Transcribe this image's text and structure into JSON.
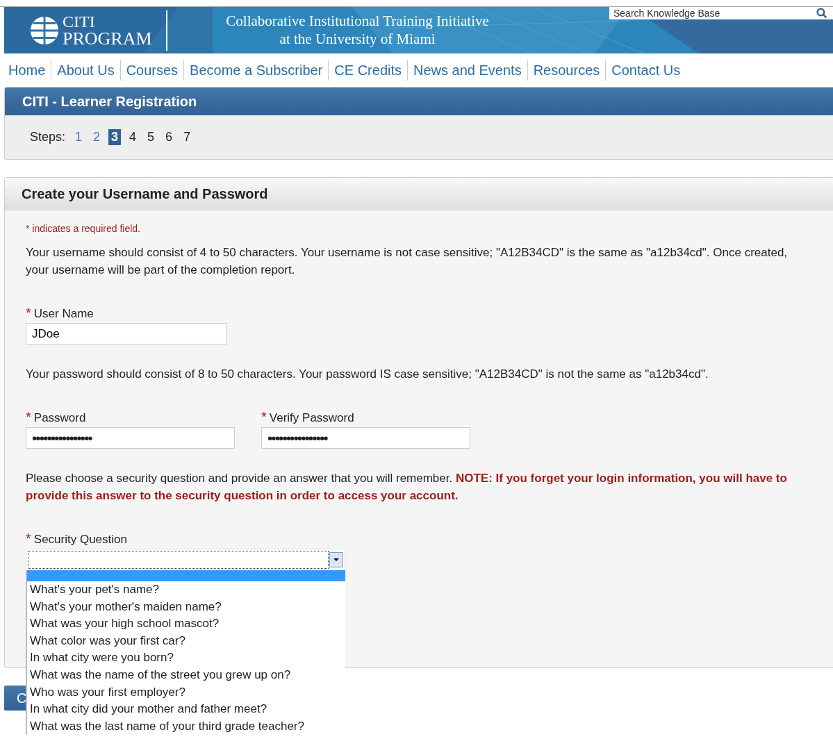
{
  "banner": {
    "logo_top": "CITI",
    "logo_bottom": "PROGRAM",
    "tagline": [
      "Collaborative Institutional Training Initiative",
      "at the University of Miami"
    ],
    "search": {
      "placeholder": "Search Knowledge Base"
    }
  },
  "nav": [
    "Home",
    "About Us",
    "Courses",
    "Become a Subscriber",
    "CE Credits",
    "News and Events",
    "Resources",
    "Contact Us"
  ],
  "registration": {
    "title": "CITI - Learner Registration",
    "steps_label": "Steps:",
    "steps": [
      {
        "label": "1",
        "kind": "done",
        "selected": false
      },
      {
        "label": "2",
        "kind": "done",
        "selected": false
      },
      {
        "label": "3",
        "kind": "current",
        "selected": true
      },
      {
        "label": "4",
        "kind": "todo",
        "selected": false
      },
      {
        "label": "5",
        "kind": "todo",
        "selected": false
      },
      {
        "label": "6",
        "kind": "todo",
        "selected": false
      },
      {
        "label": "7",
        "kind": "todo",
        "selected": false
      }
    ]
  },
  "form": {
    "title": "Create your Username and Password",
    "required_note": "* indicates a required field.",
    "username_help": "Your username should consist of 4 to 50 characters. Your username is not case sensitive; \"A12B34CD\" is the same as \"a12b34cd\". Once created, your username will be part of the completion report.",
    "username": {
      "required_mark": "*",
      "label": "User Name",
      "value": "JDoe"
    },
    "password_help": "Your password should consist of 8 to 50 characters. Your password IS case sensitive; \"A12B34CD\" is not the same as \"a12b34cd\".",
    "password": {
      "required_mark": "*",
      "label": "Password",
      "value": "••••••••••••••••"
    },
    "verify_password": {
      "required_mark": "*",
      "label": "Verify Password",
      "value": "••••••••••••••••"
    },
    "security_help": "Please choose a security question and provide an answer that you will remember.",
    "security_note": "NOTE: If you forget your login information, you will have to provide this answer to the security question in order to access your account.",
    "security_question": {
      "required_mark": "*",
      "label": "Security Question",
      "expanded": true,
      "blank_option_highlighted": true,
      "options": [
        {
          "label": "What's your pet's name?",
          "selected": false
        },
        {
          "label": "What's your mother's maiden name?",
          "selected": false
        },
        {
          "label": "What was your high school mascot?",
          "selected": false
        },
        {
          "label": "What color was your first car?",
          "selected": false
        },
        {
          "label": "In what city were you born?",
          "selected": false
        },
        {
          "label": "What was the name of the street you grew up on?",
          "selected": false
        },
        {
          "label": "Who was your first employer?",
          "selected": false
        },
        {
          "label": "In what city did your mother and father meet?",
          "selected": false
        },
        {
          "label": "What was the last name of your third grade teacher?",
          "selected": false
        }
      ]
    }
  },
  "continue_button": "C"
}
